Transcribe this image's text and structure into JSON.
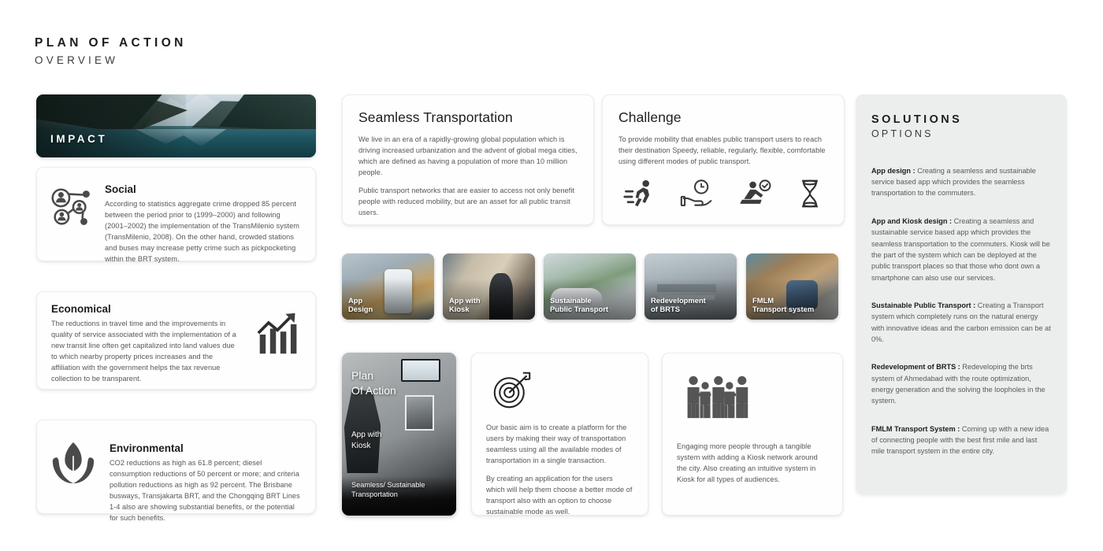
{
  "header": {
    "title": "PLAN OF ACTION",
    "subtitle": "OVERVIEW"
  },
  "impact_banner": {
    "label": "IMPACT",
    "image_alt": "mountain-lake-landscape"
  },
  "impact_cards": [
    {
      "title": "Social",
      "icon": "people-network-icon",
      "text": "According to statistics aggregate crime dropped 85 percent between the period prior to (1999–2000) and following (2001–2002) the implementation of the TransMilenio system (TransMilenio, 2008).  On the other hand, crowded stations and buses may increase petty crime such as pickpocketing within the BRT system."
    },
    {
      "title": "Economical",
      "icon": "growth-chart-arrow-icon",
      "text": "The reductions in travel time and the improvements in quality of service associated with the implementation of a new transit line often get capitalized into land values due to which nearby property prices increases and the affiliation with the government helps the tax revenue collection to be transparent."
    },
    {
      "title": "Environmental",
      "icon": "leaf-in-hands-icon",
      "text": "CO2 reductions as high as 61.8 percent;  diesel consumption reductions of 50 percent or more; and criteria pollution reductions as high as 92 percent. The Brisbane busways, Transjakarta BRT, and the Chongqing BRT Lines 1-4 also are showing substantial benefits, or the potential for such benefits."
    }
  ],
  "seamless": {
    "title": "Seamless Transportation",
    "paragraph1": "We live in an era of a rapidly-growing global population which is driving increased urbanization and the advent of global mega cities, which are defined as having a population of more than 10 million people.",
    "paragraph2": "Public transport networks that are easier to access not only benefit people with reduced mobility, but are an asset for all public transit users."
  },
  "challenge": {
    "title": "Challenge",
    "paragraph": "To provide mobility that enables public transport users to reach their destination Speedy, reliable, regularly, flexible, comfortable using different modes of public transport.",
    "icons": [
      "running-person-icon",
      "hand-with-clock-icon",
      "seated-passenger-check-icon",
      "hourglass-icon"
    ]
  },
  "thumbnails": [
    {
      "caption": "App\nDesign",
      "line1": "App",
      "line2": "Design",
      "image_alt": "smartphone-app-on-street"
    },
    {
      "caption": "App with\nKiosk",
      "line1": "App with",
      "line2": "Kiosk",
      "image_alt": "person-at-ticket-kiosk"
    },
    {
      "caption": "Sustainable\nPublic Transport",
      "line1": "Sustainable",
      "line2": "Public Transport",
      "image_alt": "futuristic-pod-transit"
    },
    {
      "caption": "Redevelopment\nof BRTS",
      "line1": "Redevelopment",
      "line2": "of BRTS",
      "image_alt": "brts-bus-station-street"
    },
    {
      "caption": "FMLM\nTransport system",
      "line1": "FMLM",
      "line2": "Transport system",
      "image_alt": "cyclist-in-city-traffic"
    }
  ],
  "poster": {
    "title_line1": "Plan",
    "title_line2": "Of Action",
    "subtitle_line1": "App with",
    "subtitle_line2": "Kiosk",
    "footer_line1": "Seamless/ Sustainable",
    "footer_line2": "Transportation",
    "image_alt": "kiosk-interior-photo"
  },
  "aim": {
    "icon": "target-dartboard-icon",
    "paragraph1": "Our basic aim is to create a platform for the users by making their way of transportation seamless using all the available modes of transportation in a single transaction.",
    "paragraph2": "By creating an application for the users which will help them choose a better mode of transport also with an option to choose sustainable mode as well."
  },
  "engage": {
    "icon": "group-of-people-icon",
    "paragraph": "Engaging more people through a tangible system with adding a Kiosk network around the city. Also creating an intuitive system in Kiosk for all types of audiences."
  },
  "solutions": {
    "title": "SOLUTIONS",
    "subtitle": "OPTIONS",
    "items": [
      {
        "label": "App design :",
        "text": " Creating a seamless and sustainable service based app which provides the seamless transportation to the commuters."
      },
      {
        "label": "App and Kiosk design :",
        "text": " Creating a seamless and sustainable service based app which provides the seamless transportation to the commuters. Kiosk will be the part of the system which can be deployed at the public transport places so that those who dont own a smartphone can also use our services."
      },
      {
        "label": "Sustainable Public Transport :",
        "text": " Creating a Transport system which completely runs on the natural energy with innovative ideas and the carbon emission can be at 0%."
      },
      {
        "label": "Redevelopment of BRTS :",
        "text": " Redeveloping the brts system of Ahmedabad with the route optimization, energy generation and the solving the loopholes in the system."
      },
      {
        "label": "FMLM Transport System :",
        "text": " Coming up with a new idea of connecting people with the best first mile and last mile transport system in the entire city."
      }
    ]
  },
  "colors": {
    "page_background": "#ffffff",
    "card_background": "#fefefe",
    "panel_background": "#eceded",
    "heading": "#1d1d1d",
    "body": "#575757",
    "icon": "#4a4a4a"
  }
}
